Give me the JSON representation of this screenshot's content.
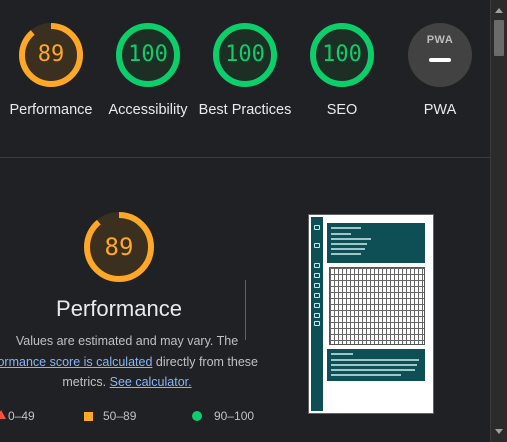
{
  "gauges": [
    {
      "label": "Performance",
      "score": "89",
      "fraction": 0.89,
      "color": "#ffa726",
      "bg": "#3b2f1f"
    },
    {
      "label": "Accessibility",
      "score": "100",
      "fraction": 1.0,
      "color": "#0cce6b",
      "bg": "#1d2f24"
    },
    {
      "label": "Best Practices",
      "score": "100",
      "fraction": 1.0,
      "color": "#0cce6b",
      "bg": "#1d2f24"
    },
    {
      "label": "SEO",
      "score": "100",
      "fraction": 1.0,
      "color": "#0cce6b",
      "bg": "#1d2f24"
    }
  ],
  "pwa": {
    "label": "PWA",
    "badge_text": "PWA"
  },
  "performance": {
    "score": "89",
    "fraction": 0.89,
    "title": "Performance",
    "desc_line1": "Values are estimated and may vary. The",
    "desc_link1": "formance score is calculated",
    "desc_line2_rest": " directly from these",
    "desc_line3_start": "metrics. ",
    "desc_link2": "See calculator."
  },
  "legend": {
    "fail": "0–49",
    "average": "50–89",
    "pass": "90–100"
  },
  "colors": {
    "average": "#ffa726",
    "pass": "#0cce6b",
    "fail": "#ff4e42",
    "link": "#8ab4f8"
  }
}
